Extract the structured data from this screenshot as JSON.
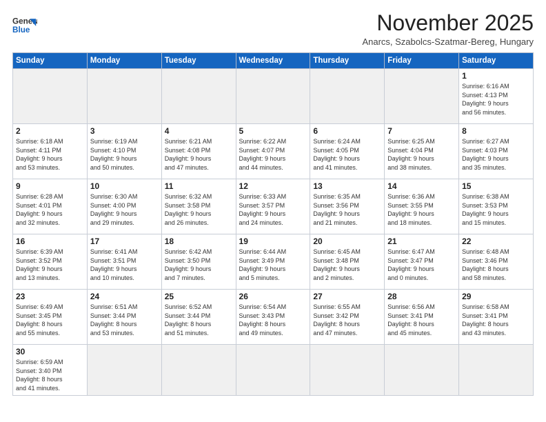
{
  "logo": {
    "line1": "General",
    "line2": "Blue"
  },
  "title": "November 2025",
  "location": "Anarcs, Szabolcs-Szatmar-Bereg, Hungary",
  "days_of_week": [
    "Sunday",
    "Monday",
    "Tuesday",
    "Wednesday",
    "Thursday",
    "Friday",
    "Saturday"
  ],
  "weeks": [
    [
      {
        "day": "",
        "info": ""
      },
      {
        "day": "",
        "info": ""
      },
      {
        "day": "",
        "info": ""
      },
      {
        "day": "",
        "info": ""
      },
      {
        "day": "",
        "info": ""
      },
      {
        "day": "",
        "info": ""
      },
      {
        "day": "1",
        "info": "Sunrise: 6:16 AM\nSunset: 4:13 PM\nDaylight: 9 hours\nand 56 minutes."
      }
    ],
    [
      {
        "day": "2",
        "info": "Sunrise: 6:18 AM\nSunset: 4:11 PM\nDaylight: 9 hours\nand 53 minutes."
      },
      {
        "day": "3",
        "info": "Sunrise: 6:19 AM\nSunset: 4:10 PM\nDaylight: 9 hours\nand 50 minutes."
      },
      {
        "day": "4",
        "info": "Sunrise: 6:21 AM\nSunset: 4:08 PM\nDaylight: 9 hours\nand 47 minutes."
      },
      {
        "day": "5",
        "info": "Sunrise: 6:22 AM\nSunset: 4:07 PM\nDaylight: 9 hours\nand 44 minutes."
      },
      {
        "day": "6",
        "info": "Sunrise: 6:24 AM\nSunset: 4:05 PM\nDaylight: 9 hours\nand 41 minutes."
      },
      {
        "day": "7",
        "info": "Sunrise: 6:25 AM\nSunset: 4:04 PM\nDaylight: 9 hours\nand 38 minutes."
      },
      {
        "day": "8",
        "info": "Sunrise: 6:27 AM\nSunset: 4:03 PM\nDaylight: 9 hours\nand 35 minutes."
      }
    ],
    [
      {
        "day": "9",
        "info": "Sunrise: 6:28 AM\nSunset: 4:01 PM\nDaylight: 9 hours\nand 32 minutes."
      },
      {
        "day": "10",
        "info": "Sunrise: 6:30 AM\nSunset: 4:00 PM\nDaylight: 9 hours\nand 29 minutes."
      },
      {
        "day": "11",
        "info": "Sunrise: 6:32 AM\nSunset: 3:58 PM\nDaylight: 9 hours\nand 26 minutes."
      },
      {
        "day": "12",
        "info": "Sunrise: 6:33 AM\nSunset: 3:57 PM\nDaylight: 9 hours\nand 24 minutes."
      },
      {
        "day": "13",
        "info": "Sunrise: 6:35 AM\nSunset: 3:56 PM\nDaylight: 9 hours\nand 21 minutes."
      },
      {
        "day": "14",
        "info": "Sunrise: 6:36 AM\nSunset: 3:55 PM\nDaylight: 9 hours\nand 18 minutes."
      },
      {
        "day": "15",
        "info": "Sunrise: 6:38 AM\nSunset: 3:53 PM\nDaylight: 9 hours\nand 15 minutes."
      }
    ],
    [
      {
        "day": "16",
        "info": "Sunrise: 6:39 AM\nSunset: 3:52 PM\nDaylight: 9 hours\nand 13 minutes."
      },
      {
        "day": "17",
        "info": "Sunrise: 6:41 AM\nSunset: 3:51 PM\nDaylight: 9 hours\nand 10 minutes."
      },
      {
        "day": "18",
        "info": "Sunrise: 6:42 AM\nSunset: 3:50 PM\nDaylight: 9 hours\nand 7 minutes."
      },
      {
        "day": "19",
        "info": "Sunrise: 6:44 AM\nSunset: 3:49 PM\nDaylight: 9 hours\nand 5 minutes."
      },
      {
        "day": "20",
        "info": "Sunrise: 6:45 AM\nSunset: 3:48 PM\nDaylight: 9 hours\nand 2 minutes."
      },
      {
        "day": "21",
        "info": "Sunrise: 6:47 AM\nSunset: 3:47 PM\nDaylight: 9 hours\nand 0 minutes."
      },
      {
        "day": "22",
        "info": "Sunrise: 6:48 AM\nSunset: 3:46 PM\nDaylight: 8 hours\nand 58 minutes."
      }
    ],
    [
      {
        "day": "23",
        "info": "Sunrise: 6:49 AM\nSunset: 3:45 PM\nDaylight: 8 hours\nand 55 minutes."
      },
      {
        "day": "24",
        "info": "Sunrise: 6:51 AM\nSunset: 3:44 PM\nDaylight: 8 hours\nand 53 minutes."
      },
      {
        "day": "25",
        "info": "Sunrise: 6:52 AM\nSunset: 3:44 PM\nDaylight: 8 hours\nand 51 minutes."
      },
      {
        "day": "26",
        "info": "Sunrise: 6:54 AM\nSunset: 3:43 PM\nDaylight: 8 hours\nand 49 minutes."
      },
      {
        "day": "27",
        "info": "Sunrise: 6:55 AM\nSunset: 3:42 PM\nDaylight: 8 hours\nand 47 minutes."
      },
      {
        "day": "28",
        "info": "Sunrise: 6:56 AM\nSunset: 3:41 PM\nDaylight: 8 hours\nand 45 minutes."
      },
      {
        "day": "29",
        "info": "Sunrise: 6:58 AM\nSunset: 3:41 PM\nDaylight: 8 hours\nand 43 minutes."
      }
    ],
    [
      {
        "day": "30",
        "info": "Sunrise: 6:59 AM\nSunset: 3:40 PM\nDaylight: 8 hours\nand 41 minutes."
      },
      {
        "day": "",
        "info": ""
      },
      {
        "day": "",
        "info": ""
      },
      {
        "day": "",
        "info": ""
      },
      {
        "day": "",
        "info": ""
      },
      {
        "day": "",
        "info": ""
      },
      {
        "day": "",
        "info": ""
      }
    ]
  ]
}
